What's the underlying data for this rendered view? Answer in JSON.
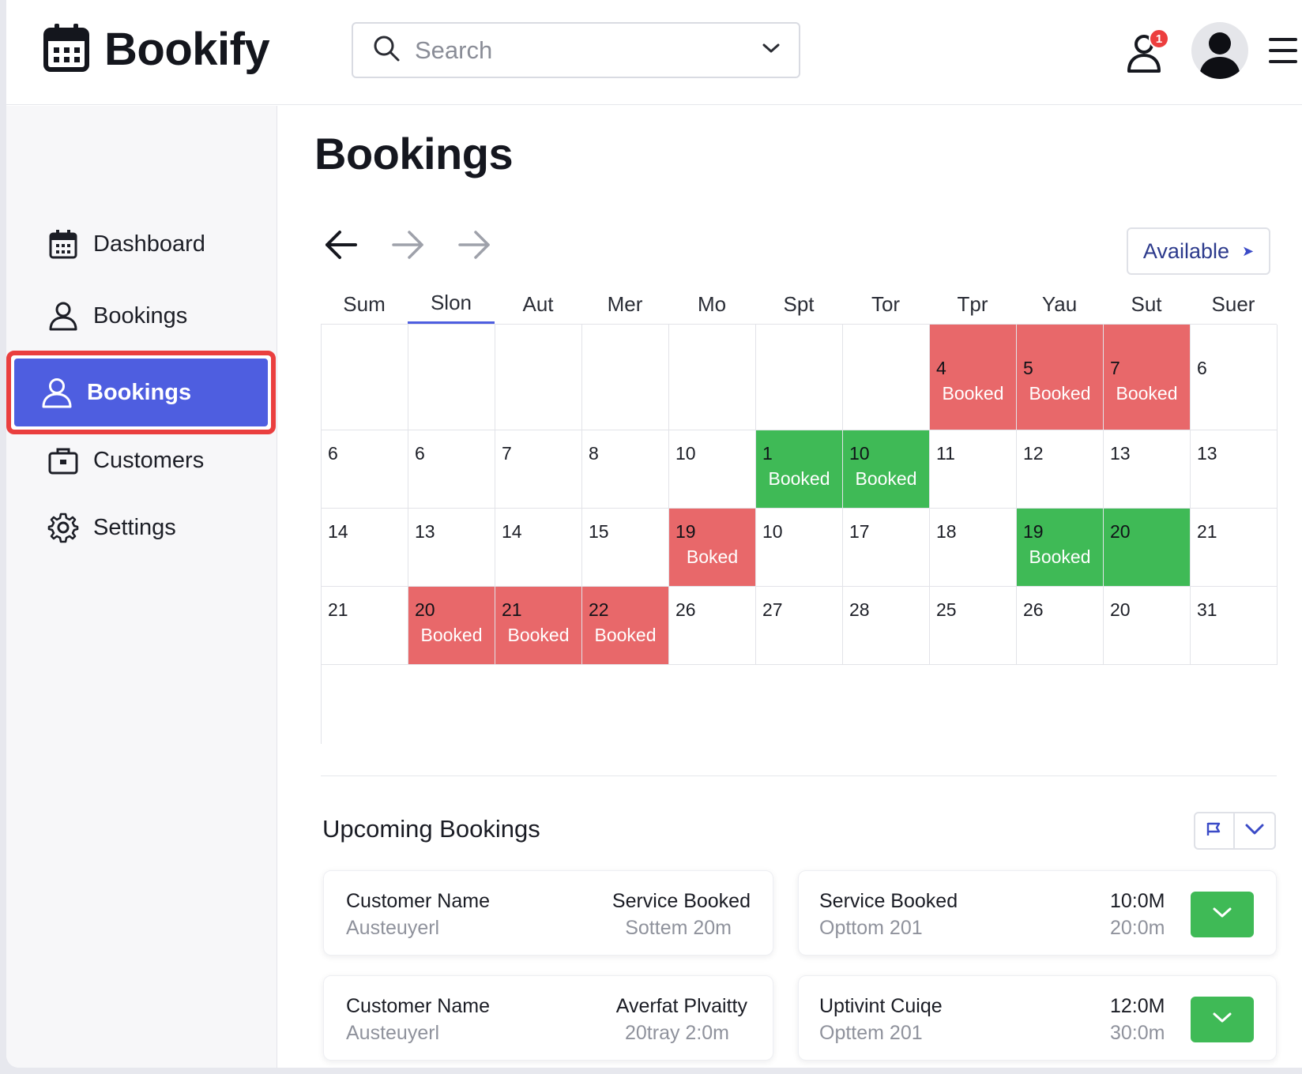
{
  "app": {
    "name": "Bookify"
  },
  "header": {
    "search_placeholder": "Search",
    "notification_count": "1"
  },
  "sidebar": {
    "items": [
      {
        "label": "Dashboard",
        "icon": "calendar-icon"
      },
      {
        "label": "Bookings",
        "icon": "user-icon"
      },
      {
        "label": "Bookings",
        "icon": "user-icon",
        "active": true
      },
      {
        "label": "Customers",
        "icon": "briefcase-icon"
      },
      {
        "label": "Settings",
        "icon": "gear-icon"
      }
    ]
  },
  "main": {
    "title": "Bookings",
    "filter_label": "Available",
    "day_headers": [
      "Sum",
      "Slon",
      "Aut",
      "Mer",
      "Mo",
      "Spt",
      "Tor",
      "Tpr",
      "Yau",
      "Sut",
      "Suer"
    ],
    "active_day_index": 1,
    "calendar_rows": [
      [
        {
          "n": "",
          "s": ""
        },
        {
          "n": "",
          "s": ""
        },
        {
          "n": "",
          "s": ""
        },
        {
          "n": "",
          "s": ""
        },
        {
          "n": "",
          "s": ""
        },
        {
          "n": "",
          "s": ""
        },
        {
          "n": "",
          "s": ""
        },
        {
          "n": "4",
          "s": "red",
          "l": "Booked"
        },
        {
          "n": "5",
          "s": "red",
          "l": "Booked"
        },
        {
          "n": "7",
          "s": "red",
          "l": "Booked"
        },
        {
          "n": "6",
          "s": ""
        }
      ],
      [
        {
          "n": "6",
          "s": ""
        },
        {
          "n": "6",
          "s": ""
        },
        {
          "n": "7",
          "s": ""
        },
        {
          "n": "8",
          "s": ""
        },
        {
          "n": "10",
          "s": ""
        },
        {
          "n": "1",
          "s": "green",
          "l": "Booked"
        },
        {
          "n": "10",
          "s": "green",
          "l": "Booked"
        },
        {
          "n": "11",
          "s": ""
        },
        {
          "n": "12",
          "s": ""
        },
        {
          "n": "13",
          "s": ""
        },
        {
          "n": "13",
          "s": ""
        }
      ],
      [
        {
          "n": "14",
          "s": ""
        },
        {
          "n": "13",
          "s": ""
        },
        {
          "n": "14",
          "s": ""
        },
        {
          "n": "15",
          "s": ""
        },
        {
          "n": "19",
          "s": "red",
          "l": "Boked"
        },
        {
          "n": "10",
          "s": ""
        },
        {
          "n": "17",
          "s": ""
        },
        {
          "n": "18",
          "s": ""
        },
        {
          "n": "19",
          "s": "green",
          "l": "Booked"
        },
        {
          "n": "20",
          "s": "green"
        },
        {
          "n": "21",
          "s": ""
        }
      ],
      [
        {
          "n": "21",
          "s": ""
        },
        {
          "n": "20",
          "s": "red",
          "l": "Booked"
        },
        {
          "n": "21",
          "s": "red",
          "l": "Booked"
        },
        {
          "n": "22",
          "s": "red",
          "l": "Booked"
        },
        {
          "n": "26",
          "s": ""
        },
        {
          "n": "27",
          "s": ""
        },
        {
          "n": "28",
          "s": ""
        },
        {
          "n": "25",
          "s": ""
        },
        {
          "n": "26",
          "s": ""
        },
        {
          "n": "20",
          "s": ""
        },
        {
          "n": "31",
          "s": ""
        }
      ]
    ]
  },
  "upcoming": {
    "title": "Upcoming Bookings",
    "cards": [
      {
        "name_label": "Customer Name",
        "name_value": "Austeuyerl",
        "svc_label": "Service Booked",
        "svc_value": "Sottem 20m"
      },
      {
        "svc_label": "Service Booked",
        "svc_value": "Opttom 201",
        "time": "10:0M",
        "time_sub": "20:0m"
      },
      {
        "name_label": "Customer Name",
        "name_value": "Austeuyerl",
        "svc_label": "Averfat Plvaitty",
        "svc_value": "20tray 2:0m"
      },
      {
        "svc_label": "Uptivint Cuiqe",
        "svc_value": "Opttem 201",
        "time": "12:0M",
        "time_sub": "30:0m"
      }
    ]
  },
  "colors": {
    "accent": "#4e5ee0",
    "booked_red": "#e8686a",
    "booked_green": "#3fba56",
    "highlight_outline": "#ea3f3f",
    "badge": "#ec3e3e"
  }
}
